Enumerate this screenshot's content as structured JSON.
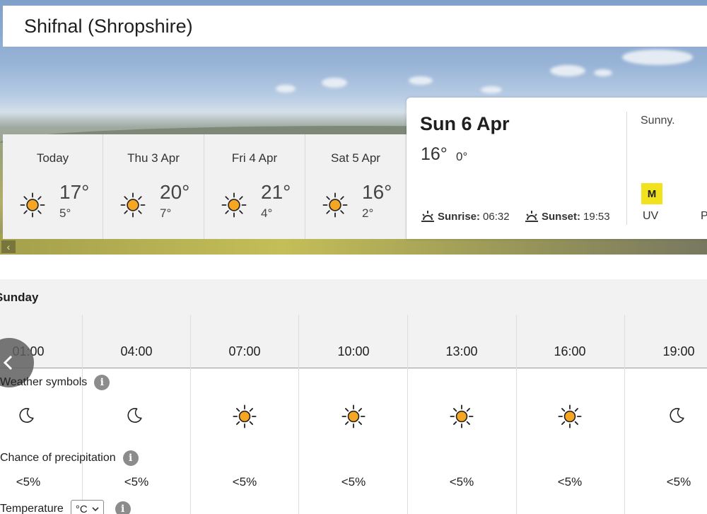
{
  "location": {
    "name": "Shifnal (Shropshire)"
  },
  "days": [
    {
      "label": "Today",
      "max": "17°",
      "min": "5°",
      "icon": "sun-icon"
    },
    {
      "label": "Thu 3 Apr",
      "max": "20°",
      "min": "7°",
      "icon": "sun-icon"
    },
    {
      "label": "Fri 4 Apr",
      "max": "21°",
      "min": "4°",
      "icon": "sun-icon"
    },
    {
      "label": "Sat 5 Apr",
      "max": "16°",
      "min": "2°",
      "icon": "sun-icon"
    }
  ],
  "selected_day": {
    "title": "Sun 6 Apr",
    "max": "16°",
    "min": "0°",
    "summary": "Sunny.",
    "sunrise_label": "Sunrise:",
    "sunrise": "06:32",
    "sunset_label": "Sunset:",
    "sunset": "19:53",
    "uv_value": "M",
    "uv_label": "UV",
    "p_label": "P"
  },
  "hourly": {
    "day_heading": "Sunday",
    "times": [
      "01:00",
      "04:00",
      "07:00",
      "10:00",
      "13:00",
      "16:00",
      "19:00"
    ],
    "symbols": [
      "moon-icon",
      "moon-icon",
      "sun-icon",
      "sun-icon",
      "sun-icon",
      "sun-icon",
      "moon-icon"
    ],
    "precip": [
      "<5%",
      "<5%",
      "<5%",
      "<5%",
      "<5%",
      "<5%",
      "<5%"
    ],
    "weather_symbols_label": "Weather symbols",
    "precip_label": "Chance of precipitation",
    "temperature_label": "Temperature",
    "unit_selected": "°C",
    "info_glyph": "i"
  },
  "colors": {
    "sun": "#f5a623",
    "uv_moderate": "#f2e11d",
    "tab_bg": "#f1f1f1"
  }
}
